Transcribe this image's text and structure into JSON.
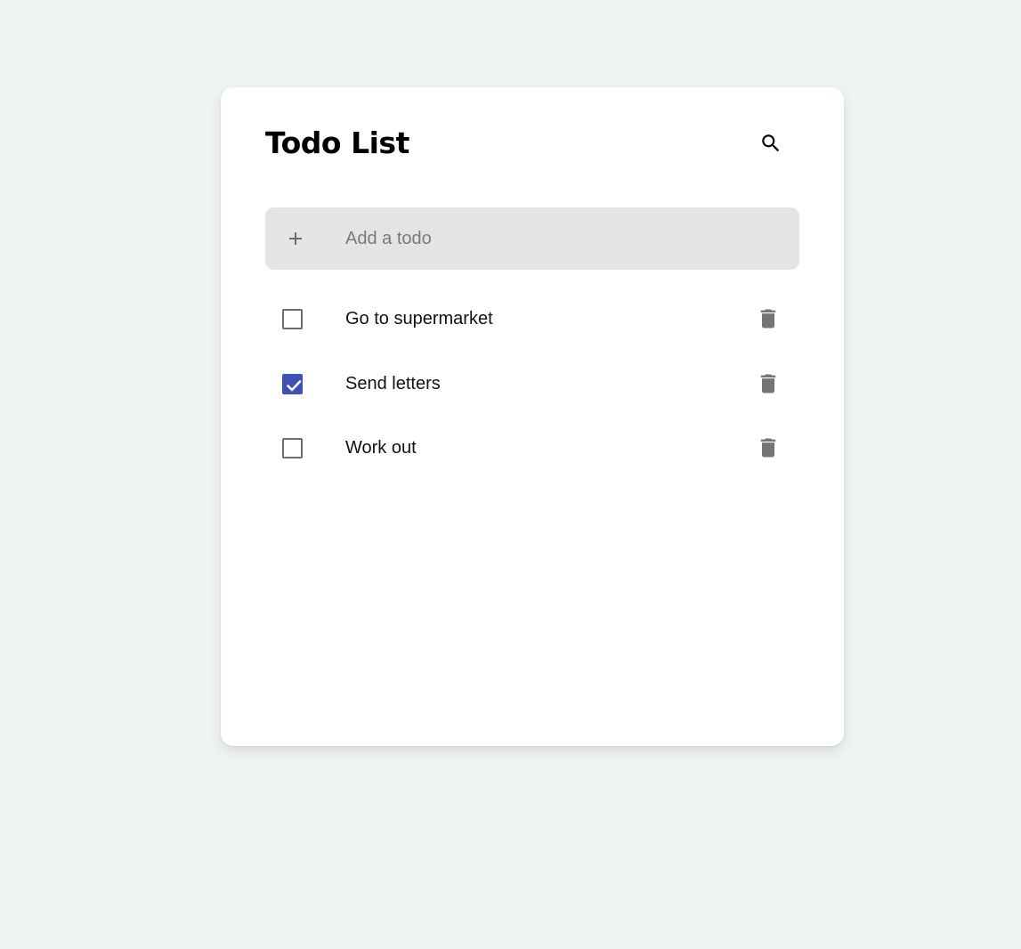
{
  "header": {
    "title": "Todo List",
    "search_icon": "search-icon"
  },
  "add_todo": {
    "placeholder": "Add a todo",
    "value": "",
    "icon": "plus-icon"
  },
  "todos": [
    {
      "label": "Go to supermarket",
      "checked": false,
      "delete_icon": "trash-icon"
    },
    {
      "label": "Send letters",
      "checked": true,
      "delete_icon": "trash-icon"
    },
    {
      "label": "Work out",
      "checked": false,
      "delete_icon": "trash-icon"
    }
  ],
  "colors": {
    "background": "#f0f4f1",
    "card": "#ffffff",
    "input_background": "#e4e4e4",
    "checkbox_checked": "#3f51b5",
    "icon_gray": "#757575"
  }
}
